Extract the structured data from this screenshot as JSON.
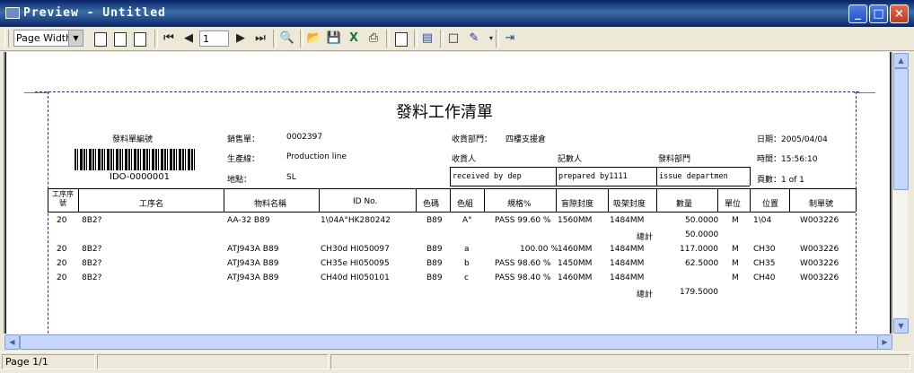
{
  "window": {
    "title": "Preview - Untitled",
    "min": "_",
    "max": "□",
    "close": "×"
  },
  "toolbar": {
    "zoom_value": "Page Width",
    "page_number": "1",
    "icons": [
      "one-page-icon",
      "two-page-icon",
      "multi-page-icon",
      "first-page-icon",
      "prev-page-icon",
      "next-page-icon",
      "last-page-icon",
      "find-icon",
      "open-icon",
      "save-icon",
      "excel-icon",
      "print-icon",
      "new-page-icon",
      "page-setup-icon",
      "frame-icon",
      "color-icon",
      "exit-icon"
    ]
  },
  "report": {
    "title": "發料工作清單",
    "barcode_label": "發料單編號",
    "barcode_value": "IDO-0000001",
    "sales_label": "銷售單：",
    "sales_value": "0002397",
    "line_label": "生產線：",
    "line_value": "Production line",
    "place_label": "地點：",
    "place_value": "SL",
    "recv_dept_label": "收貨部門：",
    "recv_dept_value": "四樓支援倉",
    "receiver_label": "收貨人",
    "recorder_label": "記數人",
    "issue_dept_label": "發料部門",
    "receiver_box": "received by dep",
    "prepared_box": "prepared by1111",
    "issue_box": "issue departmen",
    "date_label": "日期：2005/04/04",
    "time_label": "時間：15:56:10",
    "page_label": "頁數：1 of 1",
    "headers": [
      "工序序號",
      "工序名",
      "物料名稱",
      "ID No.",
      "色碼",
      "色組",
      "規格%",
      "盲隙封度",
      "吸架封度",
      "數量",
      "單位",
      "位置",
      "制單號"
    ],
    "rows": [
      {
        "seq": "20",
        "name": "8B2?",
        "material": "AA-32    B89",
        "idno": "1\\04A°HK280242",
        "color": "B89",
        "group": "A°",
        "spec": "PASS   99.60 %",
        "w1": "1560MM",
        "w2": "1484MM",
        "qty": "50.0000",
        "unit": "M",
        "loc": "1\\04",
        "order": "W003226"
      },
      {
        "total_label": "總計",
        "total_value": "50.0000"
      },
      {
        "seq": "20",
        "name": "8B2?",
        "material": "ATJ943A  B89",
        "idno": "CH30d HI050097",
        "color": "B89",
        "group": "a",
        "spec": "100.00 %",
        "w1": "1460MM",
        "w2": "1484MM",
        "qty": "117.0000",
        "unit": "M",
        "loc": "CH30",
        "order": "W003226"
      },
      {
        "seq": "20",
        "name": "8B2?",
        "material": "ATJ943A  B89",
        "idno": "CH35e HI050095",
        "color": "B89",
        "group": "b",
        "spec": "PASS   98.60 %",
        "w1": "1450MM",
        "w2": "1484MM",
        "qty": "62.5000",
        "unit": "M",
        "loc": "CH35",
        "order": "W003226"
      },
      {
        "seq": "20",
        "name": "8B2?",
        "material": "ATJ943A  B89",
        "idno": "CH40d HI050101",
        "color": "B89",
        "group": "c",
        "spec": "PASS   98.40 %",
        "w1": "1460MM",
        "w2": "1484MM",
        "qty": "",
        "unit": "M",
        "loc": "CH40",
        "order": "W003226"
      },
      {
        "total_label": "總計",
        "total_value": "179.5000"
      }
    ]
  },
  "status": {
    "page": "Page 1/1"
  }
}
